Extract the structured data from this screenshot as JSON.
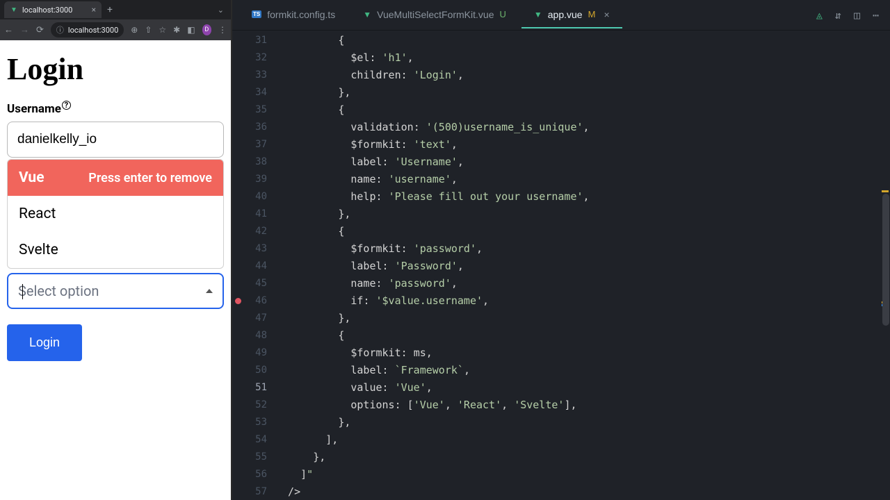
{
  "browser": {
    "tab_title": "localhost:3000",
    "address": "localhost:3000",
    "avatar_letter": "D"
  },
  "page": {
    "heading": "Login",
    "username_label": "Username",
    "username_value": "danielkelly_io",
    "dropdown": {
      "selected": "Vue",
      "selected_hint": "Press enter to remove",
      "options": [
        "React",
        "Svelte"
      ]
    },
    "select_placeholder": "Select option",
    "submit_label": "Login"
  },
  "editor": {
    "tabs": [
      {
        "icon": "ts",
        "label": "formkit.config.ts",
        "status": "",
        "active": false
      },
      {
        "icon": "vue",
        "label": "VueMultiSelectFormKit.vue",
        "status": "U",
        "active": false
      },
      {
        "icon": "vue",
        "label": "app.vue",
        "status": "M",
        "active": true
      }
    ],
    "line_start": 31,
    "line_end": 57,
    "current_line": 51,
    "breakpoint_line": 46,
    "code_lines": [
      "          {",
      "            $el: 'h1',",
      "            children: 'Login',",
      "          },",
      "          {",
      "            validation: '(500)username_is_unique',",
      "            $formkit: 'text',",
      "            label: 'Username',",
      "            name: 'username',",
      "            help: 'Please fill out your username',",
      "          },",
      "          {",
      "            $formkit: 'password',",
      "            label: 'Password',",
      "            name: 'password',",
      "            if: '$value.username',",
      "          },",
      "          {",
      "            $formkit: ms,",
      "            label: `Framework`,",
      "            value: 'Vue',",
      "            options: ['Vue', 'React', 'Svelte'],",
      "          },",
      "        ],",
      "      },",
      "    ]\"",
      "  />"
    ]
  }
}
